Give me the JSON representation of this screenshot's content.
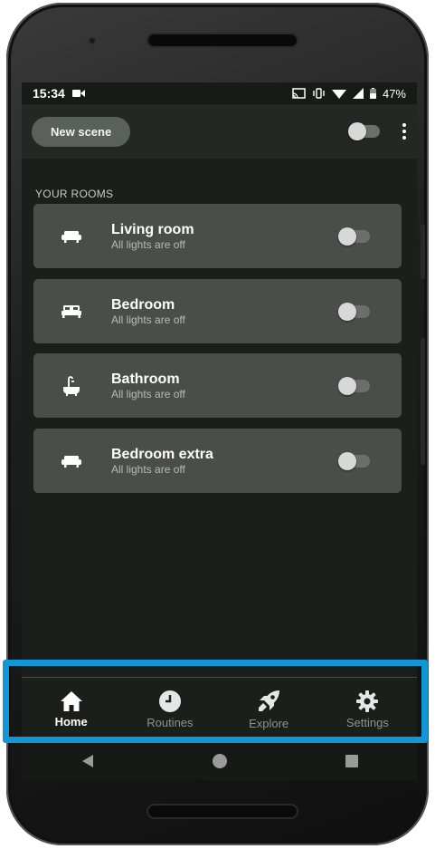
{
  "status_bar": {
    "time": "15:34",
    "battery": "47%"
  },
  "top_bar": {
    "new_scene_label": "New scene"
  },
  "rooms_section": {
    "title": "YOUR ROOMS",
    "rooms": [
      {
        "name": "Living room",
        "status": "All lights are off",
        "icon": "sofa-icon",
        "on": false
      },
      {
        "name": "Bedroom",
        "status": "All lights are off",
        "icon": "bed-icon",
        "on": false
      },
      {
        "name": "Bathroom",
        "status": "All lights are off",
        "icon": "bathtub-icon",
        "on": false
      },
      {
        "name": "Bedroom extra",
        "status": "All lights are off",
        "icon": "sofa-icon",
        "on": false
      }
    ]
  },
  "bottom_nav": {
    "items": [
      {
        "label": "Home",
        "icon": "home-icon",
        "active": true
      },
      {
        "label": "Routines",
        "icon": "clock-icon",
        "active": false
      },
      {
        "label": "Explore",
        "icon": "rocket-icon",
        "active": false
      },
      {
        "label": "Settings",
        "icon": "gear-icon",
        "active": false
      }
    ]
  },
  "colors": {
    "highlight": "#1197d8",
    "background": "#1b1f1b",
    "card": "#4a4e4a"
  }
}
